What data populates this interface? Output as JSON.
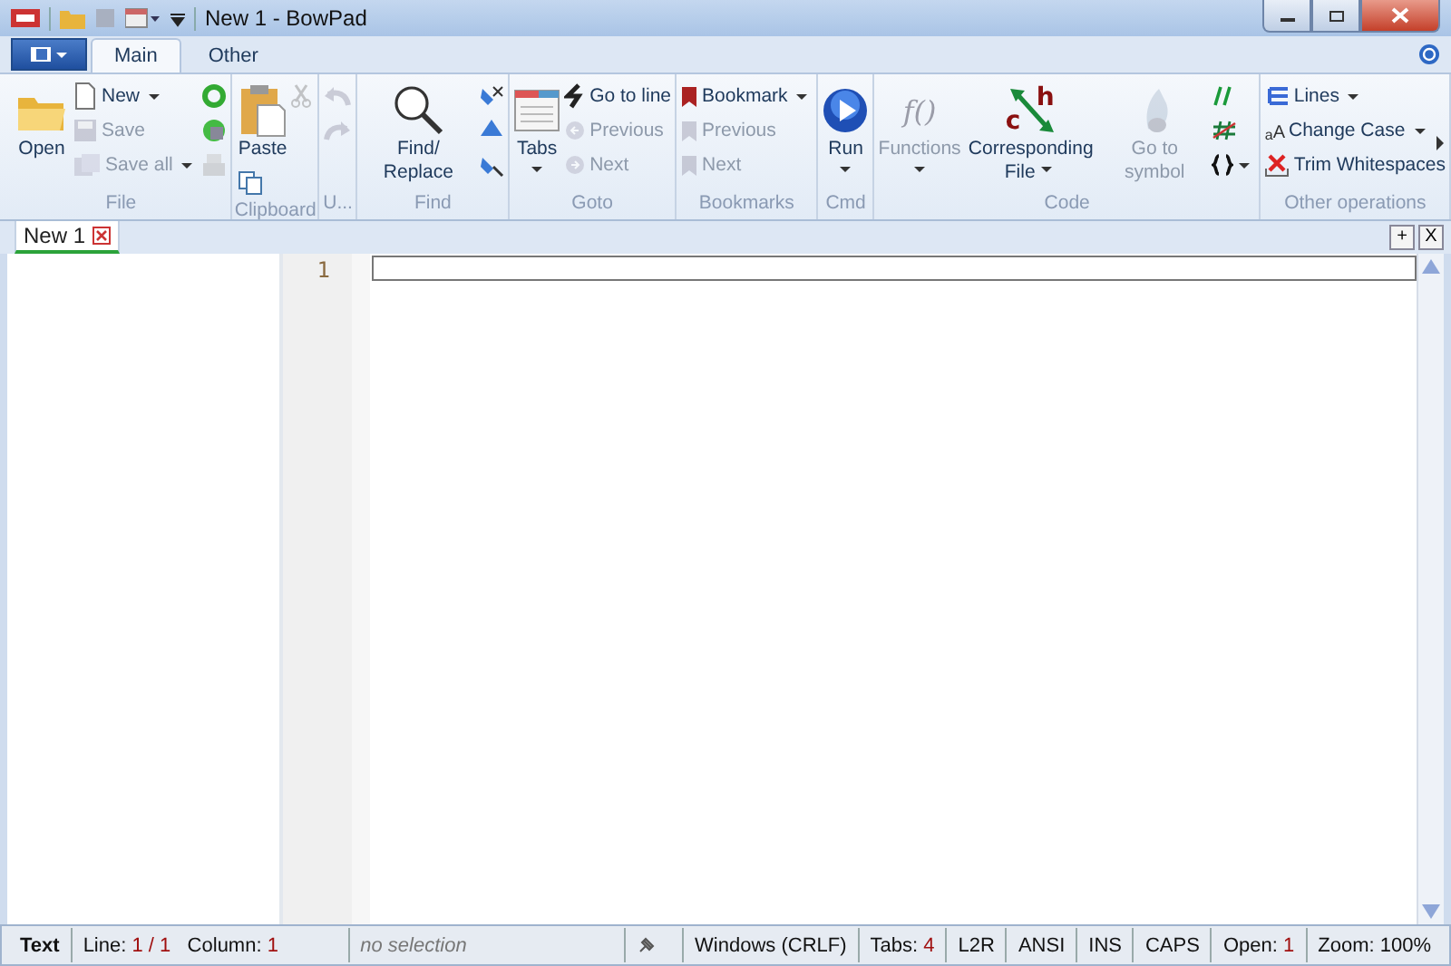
{
  "window": {
    "title": "New 1 - BowPad"
  },
  "ribbon_tabs": [
    {
      "label": "Main",
      "selected": true
    },
    {
      "label": "Other",
      "selected": false
    }
  ],
  "groups": [
    {
      "label": "File",
      "columns": [
        [
          {
            "kind": "large",
            "label": "Open",
            "disabled": false,
            "dropdown": false
          }
        ],
        [
          {
            "kind": "small",
            "label": "New",
            "disabled": false,
            "dropdown": true
          },
          {
            "kind": "small",
            "label": "Save",
            "disabled": true,
            "dropdown": false
          },
          {
            "kind": "small",
            "label": "Save all",
            "disabled": true,
            "dropdown": true
          }
        ],
        [
          {
            "kind": "icon",
            "disabled": false,
            "dropdown": false
          },
          {
            "kind": "icon",
            "disabled": false,
            "dropdown": false
          },
          {
            "kind": "icon",
            "disabled": true,
            "dropdown": false
          }
        ]
      ]
    },
    {
      "label": "Clipboard",
      "columns": [
        [
          {
            "kind": "large",
            "label": "Paste",
            "disabled": false,
            "dropdown": false
          },
          {
            "kind": "icon",
            "disabled": false,
            "dropdown": false
          }
        ],
        [
          {
            "kind": "icon",
            "disabled": true,
            "dropdown": false
          }
        ]
      ]
    },
    {
      "label": "U...",
      "columns": [
        [
          {
            "kind": "icon",
            "disabled": true,
            "dropdown": false
          },
          {
            "kind": "icon",
            "disabled": true,
            "dropdown": false
          }
        ]
      ]
    },
    {
      "label": "Find",
      "columns": [
        [
          {
            "kind": "large",
            "label": "Find/ Replace",
            "disabled": false,
            "dropdown": false
          }
        ],
        [
          {
            "kind": "icon",
            "disabled": false,
            "dropdown": false
          },
          {
            "kind": "icon",
            "disabled": false,
            "dropdown": false
          },
          {
            "kind": "icon",
            "disabled": false,
            "dropdown": false
          }
        ]
      ]
    },
    {
      "label": "Goto",
      "columns": [
        [
          {
            "kind": "large",
            "label": "Tabs",
            "disabled": false,
            "dropdown": true
          }
        ],
        [
          {
            "kind": "small",
            "label": "Go to line",
            "disabled": false,
            "dropdown": false
          },
          {
            "kind": "small",
            "label": "Previous",
            "disabled": true,
            "dropdown": false
          },
          {
            "kind": "small",
            "label": "Next",
            "disabled": true,
            "dropdown": false
          }
        ]
      ]
    },
    {
      "label": "Bookmarks",
      "columns": [
        [
          {
            "kind": "small",
            "label": "Bookmark",
            "disabled": false,
            "dropdown": true
          },
          {
            "kind": "small",
            "label": "Previous",
            "disabled": true,
            "dropdown": false
          },
          {
            "kind": "small",
            "label": "Next",
            "disabled": true,
            "dropdown": false
          }
        ]
      ]
    },
    {
      "label": "Cmd",
      "columns": [
        [
          {
            "kind": "large",
            "label": "Run",
            "disabled": false,
            "dropdown": true
          }
        ]
      ]
    },
    {
      "label": "Code",
      "columns": [
        [
          {
            "kind": "large",
            "label": "Functions",
            "disabled": true,
            "dropdown": true,
            "glyphs": [
              "f()"
            ]
          }
        ],
        [
          {
            "kind": "large",
            "label": "Corresponding File",
            "disabled": false,
            "dropdown": true,
            "glyphs": [
              "c",
              "h"
            ]
          }
        ],
        [
          {
            "kind": "large",
            "label": "Go to symbol",
            "disabled": true,
            "dropdown": false
          }
        ],
        [
          {
            "kind": "icon",
            "disabled": false,
            "dropdown": false
          },
          {
            "kind": "icon",
            "disabled": false,
            "dropdown": false
          },
          {
            "kind": "icon",
            "disabled": false,
            "dropdown": true
          }
        ]
      ]
    },
    {
      "label": "Other operations",
      "columns": [
        [
          {
            "kind": "small",
            "label": "Lines",
            "disabled": false,
            "dropdown": true
          },
          {
            "kind": "small",
            "label": "Change Case",
            "disabled": false,
            "dropdown": true,
            "glyphs": [
              "a",
              "A"
            ]
          },
          {
            "kind": "small",
            "label": "Trim Whitespaces",
            "disabled": false,
            "dropdown": false
          }
        ]
      ]
    }
  ],
  "doc_tabs": [
    {
      "label": "New 1",
      "selected": true
    }
  ],
  "doc_tab_buttons": [
    "+",
    "X"
  ],
  "editor": {
    "line_numbers": [
      "1"
    ]
  },
  "status_bar": [
    {
      "kind": "mode",
      "text": "Text"
    },
    {
      "kind": "position",
      "line_label": "Line:",
      "line": "1 / 1",
      "column_label": "Column:",
      "column": "1"
    },
    {
      "kind": "selection",
      "text": "no selection"
    },
    {
      "kind": "icon"
    },
    {
      "kind": "value",
      "label": "Windows (CRLF)"
    },
    {
      "kind": "value",
      "label": "Tabs:",
      "value": "4",
      "highlight": true
    },
    {
      "kind": "value",
      "label": "L2R"
    },
    {
      "kind": "value",
      "label": "ANSI"
    },
    {
      "kind": "value",
      "label": "INS"
    },
    {
      "kind": "value",
      "label": "CAPS"
    },
    {
      "kind": "value",
      "label": "Open:",
      "value": "1",
      "highlight": true
    },
    {
      "kind": "value",
      "label": "Zoom:",
      "value": "100%",
      "highlight": false
    }
  ]
}
